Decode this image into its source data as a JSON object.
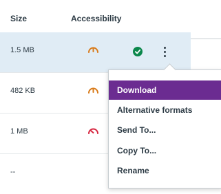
{
  "table": {
    "headers": {
      "size": "Size",
      "accessibility": "Accessibility"
    },
    "rows": [
      {
        "size": "1.5 MB",
        "gauge_color": "#d97b1a",
        "selected": true
      },
      {
        "size": "482 KB",
        "gauge_color": "#d97b1a",
        "selected": false
      },
      {
        "size": "1 MB",
        "gauge_color": "#d6243e",
        "selected": false
      },
      {
        "size": "--",
        "selected": false
      }
    ]
  },
  "menu": {
    "items": [
      {
        "label": "Download",
        "active": true
      },
      {
        "label": "Alternative formats"
      },
      {
        "label": "Send To..."
      },
      {
        "label": "Copy To..."
      },
      {
        "label": "Rename"
      }
    ]
  },
  "colors": {
    "accent": "#6b2c91",
    "success": "#0b874b",
    "row_selected": "#e0ecf5"
  },
  "icons": {
    "gauge": "gauge-icon",
    "check": "check-circle-icon",
    "more": "kebab-menu-icon"
  }
}
